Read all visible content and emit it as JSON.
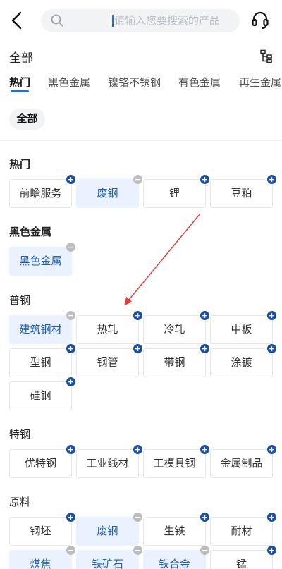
{
  "search": {
    "placeholder": "请输入您要搜索的产品"
  },
  "section": {
    "title": "全部"
  },
  "tabs": [
    {
      "label": "热门"
    },
    {
      "label": "黑色金属"
    },
    {
      "label": "镍铬不锈钢"
    },
    {
      "label": "有色金属"
    },
    {
      "label": "再生金属"
    }
  ],
  "filter": {
    "all_label": "全部"
  },
  "groups": [
    {
      "title": "热门",
      "items": [
        {
          "label": "前瞻服务",
          "selected": false,
          "badge": "plus"
        },
        {
          "label": "废钢",
          "selected": true,
          "badge": "minus"
        },
        {
          "label": "锂",
          "selected": false,
          "badge": "plus"
        },
        {
          "label": "豆粕",
          "selected": false,
          "badge": "plus"
        }
      ]
    },
    {
      "title": "黑色金属",
      "items": [
        {
          "label": "黑色金属",
          "selected": true,
          "badge": "minus"
        }
      ]
    },
    {
      "title": "普钢",
      "items": [
        {
          "label": "建筑钢材",
          "selected": true,
          "badge": "minus"
        },
        {
          "label": "热轧",
          "selected": false,
          "badge": "plus"
        },
        {
          "label": "冷轧",
          "selected": false,
          "badge": "plus"
        },
        {
          "label": "中板",
          "selected": false,
          "badge": "plus"
        },
        {
          "label": "型钢",
          "selected": false,
          "badge": "plus"
        },
        {
          "label": "钢管",
          "selected": false,
          "badge": "plus"
        },
        {
          "label": "带钢",
          "selected": false,
          "badge": "plus"
        },
        {
          "label": "涂镀",
          "selected": false,
          "badge": "plus"
        },
        {
          "label": "硅钢",
          "selected": false,
          "badge": "plus"
        }
      ]
    },
    {
      "title": "特钢",
      "items": [
        {
          "label": "优特钢",
          "selected": false,
          "badge": "plus"
        },
        {
          "label": "工业线材",
          "selected": false,
          "badge": "plus"
        },
        {
          "label": "工模具钢",
          "selected": false,
          "badge": "plus"
        },
        {
          "label": "金属制品",
          "selected": false,
          "badge": "plus"
        }
      ]
    },
    {
      "title": "原料",
      "items": [
        {
          "label": "钢坯",
          "selected": false,
          "badge": "plus"
        },
        {
          "label": "废钢",
          "selected": true,
          "badge": "minus"
        },
        {
          "label": "生铁",
          "selected": false,
          "badge": "plus"
        },
        {
          "label": "耐材",
          "selected": false,
          "badge": "plus"
        },
        {
          "label": "煤焦",
          "selected": true,
          "badge": "minus"
        },
        {
          "label": "铁矿石",
          "selected": true,
          "badge": "minus"
        },
        {
          "label": "铁合金",
          "selected": true,
          "badge": "minus"
        },
        {
          "label": "锰",
          "selected": false,
          "badge": "plus"
        }
      ]
    }
  ],
  "colors": {
    "accent": "#1f6fd6",
    "selected_bg": "#eaf2ff",
    "plus_badge": "#1d4fa6",
    "minus_badge": "#bdbdbd",
    "arrow": "#e53935"
  },
  "icons": {
    "back": "chevron-left-icon",
    "search": "search-icon",
    "service": "headset-icon",
    "tree": "tree-structure-icon",
    "add": "plus-icon",
    "remove": "minus-icon"
  }
}
